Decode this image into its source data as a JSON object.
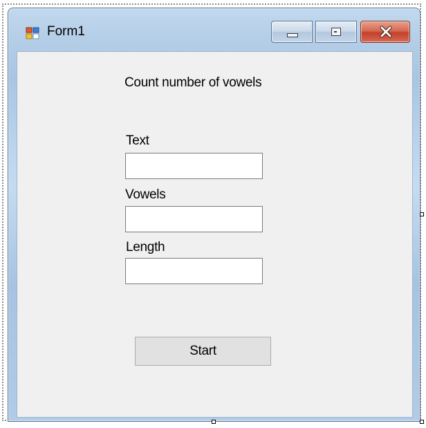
{
  "window": {
    "title": "Form1",
    "icon": "winforms-app-icon",
    "controls": {
      "minimize": "minimize-icon",
      "maximize": "maximize-icon",
      "close": "close-icon"
    }
  },
  "form": {
    "heading": "Count number of vowels",
    "fields": {
      "text_label": "Text",
      "text_value": "",
      "vowels_label": "Vowels",
      "vowels_value": "",
      "length_label": "Length",
      "length_value": ""
    },
    "start_label": "Start"
  },
  "colors": {
    "client_background": "#f0f0f0",
    "window_frame": "#b6cfe8",
    "close_button": "#c2412a",
    "button_face": "#e1e1e1"
  }
}
